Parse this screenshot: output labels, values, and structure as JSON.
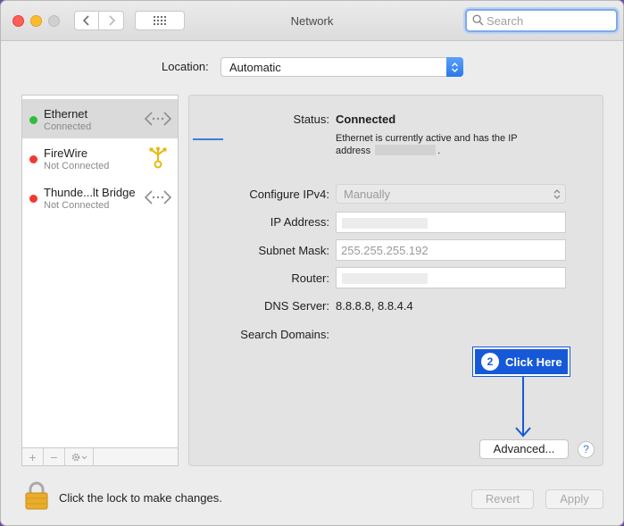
{
  "window": {
    "title": "Network"
  },
  "search": {
    "placeholder": "Search"
  },
  "toolbar": {
    "back_icon": "chevron-left-icon",
    "forward_icon": "chevron-right-icon",
    "grid_icon": "grid-icon"
  },
  "location": {
    "label": "Location:",
    "value": "Automatic"
  },
  "services": [
    {
      "name": "Ethernet",
      "status": "Connected",
      "color": "#2fbe3c",
      "icon": "ethernet-icon"
    },
    {
      "name": "FireWire",
      "status": "Not Connected",
      "color": "#ef3a32",
      "icon": "firewire-icon"
    },
    {
      "name": "Thunde...lt Bridge",
      "status": "Not Connected",
      "color": "#ef3a32",
      "icon": "thunderbolt-bridge-icon"
    }
  ],
  "sidebar_toolbar": {
    "add": "+",
    "remove": "−",
    "action_icon": "gear-icon"
  },
  "detail": {
    "status_label": "Status:",
    "status_value": "Connected",
    "status_desc_1": "Ethernet is currently active and has the IP",
    "status_desc_2": "address",
    "status_desc_3": ".",
    "configure_label": "Configure IPv4:",
    "configure_value": "Manually",
    "ip_label": "IP Address:",
    "subnet_label": "Subnet Mask:",
    "subnet_value": "255.255.255.192",
    "router_label": "Router:",
    "dns_label": "DNS Server:",
    "dns_value": "8.8.8.8, 8.8.4.4",
    "search_domains_label": "Search Domains:"
  },
  "callout": {
    "number": "2",
    "text": "Click Here",
    "color": "#1659d8"
  },
  "buttons": {
    "advanced": "Advanced...",
    "help": "?",
    "revert": "Revert",
    "apply": "Apply"
  },
  "footer": {
    "lock_text": "Click the lock to make changes."
  }
}
